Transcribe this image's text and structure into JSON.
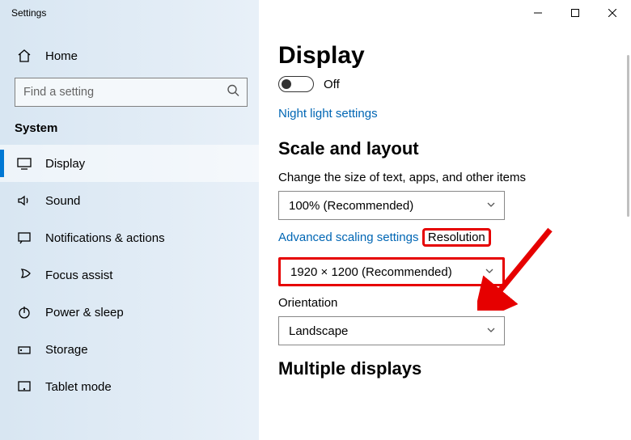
{
  "window": {
    "title": "Settings"
  },
  "sidebar": {
    "home_label": "Home",
    "search_placeholder": "Find a setting",
    "section_label": "System",
    "items": [
      {
        "label": "Display",
        "icon": "display-icon",
        "active": true
      },
      {
        "label": "Sound",
        "icon": "sound-icon",
        "active": false
      },
      {
        "label": "Notifications & actions",
        "icon": "notifications-icon",
        "active": false
      },
      {
        "label": "Focus assist",
        "icon": "focus-assist-icon",
        "active": false
      },
      {
        "label": "Power & sleep",
        "icon": "power-icon",
        "active": false
      },
      {
        "label": "Storage",
        "icon": "storage-icon",
        "active": false
      },
      {
        "label": "Tablet mode",
        "icon": "tablet-icon",
        "active": false
      }
    ]
  },
  "content": {
    "title": "Display",
    "toggle_state": "Off",
    "night_light_link": "Night light settings",
    "scale_heading": "Scale and layout",
    "scale_label": "Change the size of text, apps, and other items",
    "scale_value": "100% (Recommended)",
    "advanced_link": "Advanced scaling settings",
    "resolution_label": "Resolution",
    "resolution_value": "1920 × 1200 (Recommended)",
    "orientation_label": "Orientation",
    "orientation_value": "Landscape",
    "multiple_heading": "Multiple displays"
  },
  "annotations": {
    "highlight_resolution": true,
    "arrow_color": "#e60000"
  }
}
